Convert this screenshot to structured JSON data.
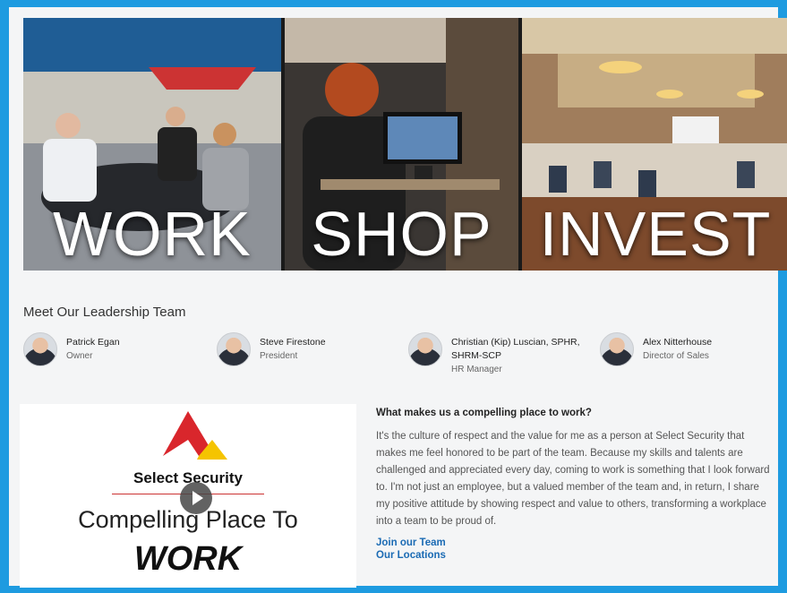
{
  "hero": {
    "panels": [
      {
        "label": "WORK"
      },
      {
        "label": "SHOP"
      },
      {
        "label": "INVEST"
      }
    ]
  },
  "leadership": {
    "title": "Meet Our Leadership Team",
    "members": [
      {
        "name": "Patrick Egan",
        "role": "Owner"
      },
      {
        "name": "Steve Firestone",
        "role": "President"
      },
      {
        "name": "Christian (Kip) Luscian, SPHR, SHRM-SCP",
        "role": "HR Manager"
      },
      {
        "name": "Alex Nitterhouse",
        "role": "Director of Sales"
      }
    ]
  },
  "video": {
    "brand": "Select Security",
    "line1": "Compelling Place To",
    "line2": "WORK"
  },
  "why": {
    "title": "What makes us a compelling place to work?",
    "body": "It's the culture of respect and the value for me as a person at Select Security that makes me feel honored to be part of the team. Because my skills and talents are challenged and appreciated every day, coming to work is something that I look forward to. I'm not just an employee, but a valued member of the team and, in return, I share my positive attitude by showing respect and value to others, transforming a workplace into a team to be proud of.",
    "links": [
      "Join our Team",
      "Our Locations"
    ]
  },
  "colors": {
    "frame": "#1e9be0",
    "link": "#1b6bb4",
    "logo_red": "#d9262c",
    "logo_yellow": "#f5c400"
  }
}
